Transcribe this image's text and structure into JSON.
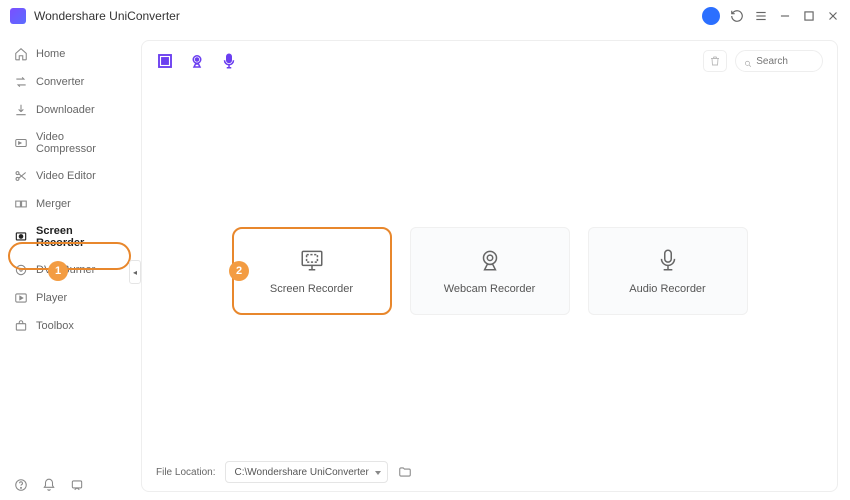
{
  "app": {
    "title": "Wondershare UniConverter"
  },
  "sidebar": {
    "items": [
      {
        "label": "Home",
        "icon": "home"
      },
      {
        "label": "Converter",
        "icon": "converter"
      },
      {
        "label": "Downloader",
        "icon": "downloader"
      },
      {
        "label": "Video Compressor",
        "icon": "compressor"
      },
      {
        "label": "Video Editor",
        "icon": "editor"
      },
      {
        "label": "Merger",
        "icon": "merger"
      },
      {
        "label": "Screen Recorder",
        "icon": "recorder"
      },
      {
        "label": "DVD Burner",
        "icon": "dvd"
      },
      {
        "label": "Player",
        "icon": "player"
      },
      {
        "label": "Toolbox",
        "icon": "toolbox"
      }
    ]
  },
  "toolbar": {
    "search_placeholder": "Search"
  },
  "cards": [
    {
      "label": "Screen Recorder"
    },
    {
      "label": "Webcam Recorder"
    },
    {
      "label": "Audio Recorder"
    }
  ],
  "footer": {
    "label": "File Location:",
    "path": "C:\\Wondershare UniConverter"
  },
  "callouts": {
    "one": "1",
    "two": "2"
  }
}
